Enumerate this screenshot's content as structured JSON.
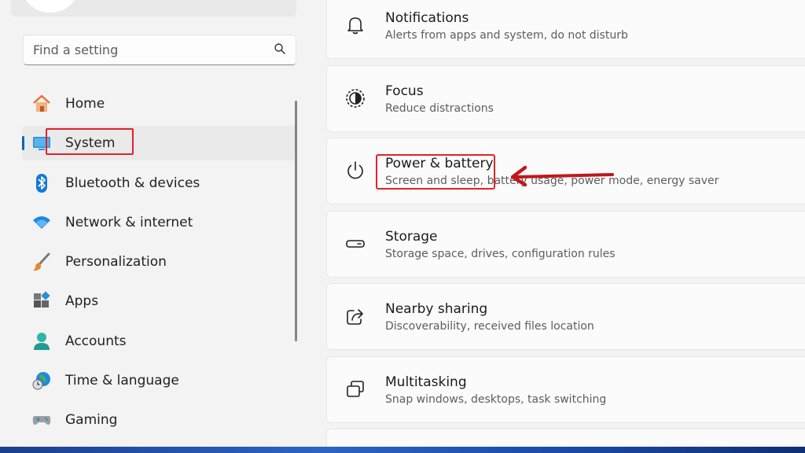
{
  "search": {
    "placeholder": "Find a setting",
    "icon": "search-icon"
  },
  "sidebar": {
    "items": [
      {
        "label": "Home",
        "icon": "home-icon"
      },
      {
        "label": "System",
        "icon": "system-icon",
        "active": true
      },
      {
        "label": "Bluetooth & devices",
        "icon": "bluetooth-icon"
      },
      {
        "label": "Network & internet",
        "icon": "wifi-icon"
      },
      {
        "label": "Personalization",
        "icon": "brush-icon"
      },
      {
        "label": "Apps",
        "icon": "apps-icon"
      },
      {
        "label": "Accounts",
        "icon": "accounts-icon"
      },
      {
        "label": "Time & language",
        "icon": "time-language-icon"
      },
      {
        "label": "Gaming",
        "icon": "gaming-icon"
      }
    ]
  },
  "settings": [
    {
      "title": "Notifications",
      "subtitle": "Alerts from apps and system, do not disturb",
      "icon": "bell-icon"
    },
    {
      "title": "Focus",
      "subtitle": "Reduce distractions",
      "icon": "focus-icon"
    },
    {
      "title": "Power & battery",
      "subtitle": "Screen and sleep, battery usage, power mode, energy saver",
      "icon": "power-icon"
    },
    {
      "title": "Storage",
      "subtitle": "Storage space, drives, configuration rules",
      "icon": "storage-icon"
    },
    {
      "title": "Nearby sharing",
      "subtitle": "Discoverability, received files location",
      "icon": "share-icon"
    },
    {
      "title": "Multitasking",
      "subtitle": "Snap windows, desktops, task switching",
      "icon": "multitasking-icon"
    }
  ],
  "colors": {
    "accent": "#0067c0",
    "annotation": "#e0232a"
  }
}
